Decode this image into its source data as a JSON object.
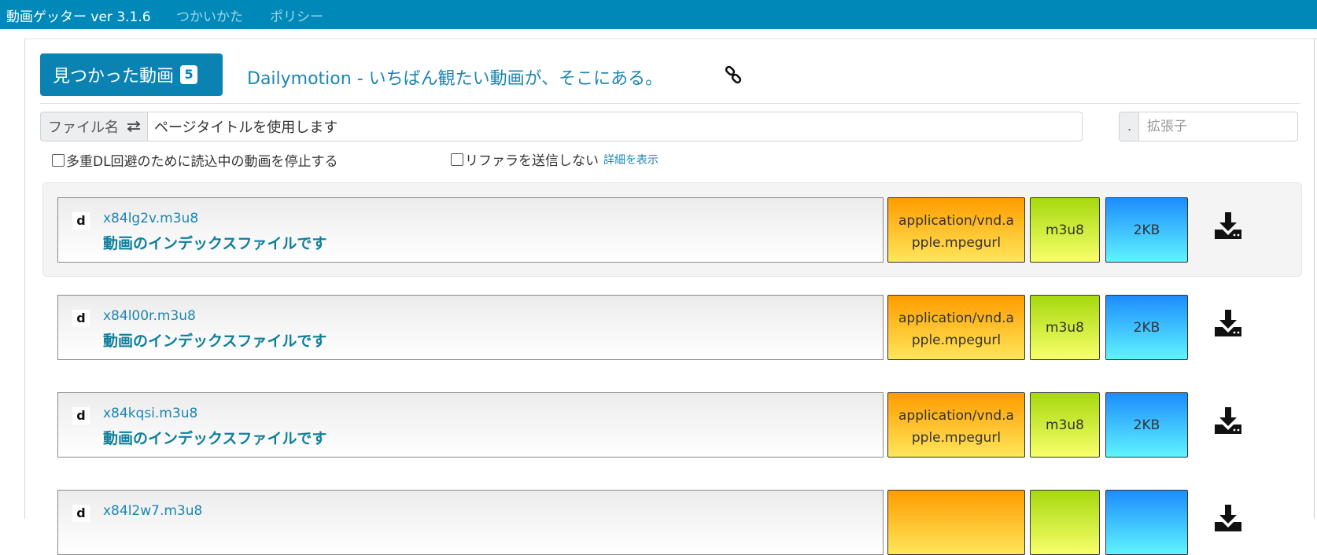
{
  "navbar": {
    "brand": "動画ゲッター ver 3.1.6",
    "links": [
      "つかいかた",
      "ポリシー"
    ]
  },
  "header": {
    "found_label": "見つかった動画",
    "found_count": "5",
    "page_title": "Dailymotion - いちばん観たい動画が、そこにある。",
    "link_icon": "link-icon"
  },
  "filename": {
    "label": "ファイル名",
    "swap_icon": "swap-arrows-icon",
    "value": "ページタイトルを使用します"
  },
  "extension": {
    "dot": ".",
    "placeholder": "拡張子"
  },
  "options": {
    "stop_loading_label": "多重DL回避のために読込中の動画を停止する",
    "stop_loading_checked": false,
    "no_referrer_label": "リファラを送信しない",
    "no_referrer_checked": false,
    "details_link": "詳細を表示"
  },
  "videos": [
    {
      "site_icon": "d",
      "filename": "x84lg2v.m3u8",
      "description": "動画のインデックスファイルです",
      "mime": "application/vnd.apple.mpegurl",
      "mime_line1": "application/vnd.a",
      "mime_line2": "pple.mpegurl",
      "ext": "m3u8",
      "size": "2KB"
    },
    {
      "site_icon": "d",
      "filename": "x84l00r.m3u8",
      "description": "動画のインデックスファイルです",
      "mime": "application/vnd.apple.mpegurl",
      "mime_line1": "application/vnd.a",
      "mime_line2": "pple.mpegurl",
      "ext": "m3u8",
      "size": "2KB"
    },
    {
      "site_icon": "d",
      "filename": "x84kqsi.m3u8",
      "description": "動画のインデックスファイルです",
      "mime": "application/vnd.apple.mpegurl",
      "mime_line1": "application/vnd.a",
      "mime_line2": "pple.mpegurl",
      "ext": "m3u8",
      "size": "2KB"
    },
    {
      "site_icon": "d",
      "filename": "x84l2w7.m3u8",
      "description": "",
      "mime": "",
      "mime_line1": "",
      "mime_line2": "",
      "ext": "",
      "size": ""
    }
  ],
  "colors": {
    "navbar": "#0089b8",
    "accent": "#0a83b3",
    "link": "#1b86b3",
    "description": "#0d7f9c",
    "mime_tag": "#ff9c00",
    "ext_tag": "#a6d90f",
    "size_tag": "#1d8cff"
  }
}
